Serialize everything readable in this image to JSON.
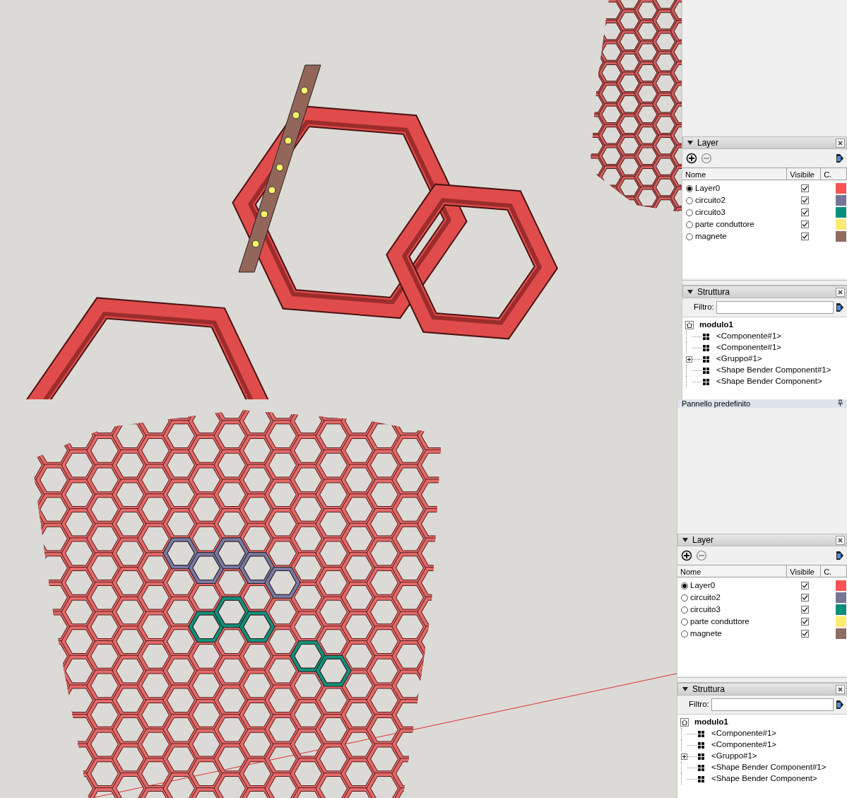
{
  "screens": [
    {
      "layers_panel": {
        "title": "Layer",
        "columns": [
          "Nome",
          "Visibile",
          "C."
        ],
        "layers": [
          {
            "name": "Layer0",
            "selected": true,
            "visible": true,
            "color": "#f65454"
          },
          {
            "name": "circuito2",
            "selected": false,
            "visible": true,
            "color": "#757597"
          },
          {
            "name": "circuito3",
            "selected": false,
            "visible": true,
            "color": "#0b8f7d"
          },
          {
            "name": "parte conduttore",
            "selected": false,
            "visible": true,
            "color": "#fceb71"
          },
          {
            "name": "magnete",
            "selected": false,
            "visible": true,
            "color": "#906c61"
          }
        ]
      },
      "outliner": {
        "title": "Struttura",
        "filter_label": "Filtro:",
        "root": "modulo1",
        "children": [
          {
            "label": "<Componente#1>",
            "kind": "component"
          },
          {
            "label": "<Componente#1>",
            "kind": "component"
          },
          {
            "label": "<Gruppo#1>",
            "kind": "group",
            "expanded": false
          },
          {
            "label": "<Shape Bender Component#1>",
            "kind": "component"
          },
          {
            "label": "<Shape Bender Component>",
            "kind": "component"
          }
        ]
      }
    },
    {
      "default_panel_title": "Pannello predefinito",
      "layers_panel": {
        "title": "Layer",
        "columns": [
          "Nome",
          "Visibile",
          "C."
        ],
        "layers": [
          {
            "name": "Layer0",
            "selected": true,
            "visible": true,
            "color": "#f65454"
          },
          {
            "name": "circuito2",
            "selected": false,
            "visible": true,
            "color": "#757597"
          },
          {
            "name": "circuito3",
            "selected": false,
            "visible": true,
            "color": "#0b8f7d"
          },
          {
            "name": "parte conduttore",
            "selected": false,
            "visible": true,
            "color": "#fceb71"
          },
          {
            "name": "magnete",
            "selected": false,
            "visible": true,
            "color": "#906c61"
          }
        ]
      },
      "outliner": {
        "title": "Struttura",
        "filter_label": "Filtro:",
        "root": "modulo1",
        "children": [
          {
            "label": "<Componente#1>",
            "kind": "component"
          },
          {
            "label": "<Componente#1>",
            "kind": "component"
          },
          {
            "label": "<Gruppo#1>",
            "kind": "group",
            "expanded": false
          },
          {
            "label": "<Shape Bender Component#1>",
            "kind": "component"
          },
          {
            "label": "<Shape Bender Component>",
            "kind": "component"
          }
        ]
      }
    }
  ]
}
